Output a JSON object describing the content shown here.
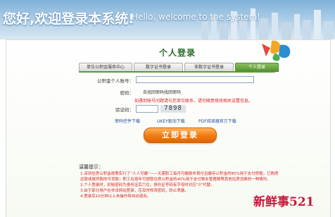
{
  "banner": {
    "title_zh": "您好,欢迎登录本系统!",
    "title_en": "Hello, welcome to the system!"
  },
  "login": {
    "title": "个人登录",
    "tabs": [
      {
        "label": "单位公积金服务中心",
        "active": false
      },
      {
        "label": "数字证书登录",
        "active": false
      },
      {
        "label": "非数字证书登录",
        "active": false
      },
      {
        "label": "个人登录",
        "active": true
      }
    ],
    "account_label": "公积金个人账号：",
    "password_label": "密码：",
    "password_hint": "去找回密码找回密码",
    "warning_text": "如遇到账号问题请与您单位联系，请勿随意修改相关设置信息。",
    "captcha_label": "验证码：",
    "captcha_value": "7898",
    "links": [
      "密码控件下载",
      "UKEY驱动下载",
      "PDF阅读器官方下载"
    ],
    "submit_label": "立即登录"
  },
  "tips": {
    "title": "温馨提示：",
    "items": [
      "1.深圳住房公积金政策实行了“人人可缴”——无需职工每月可缴款非首付且缴存公积金的85%用于支付房租；已购房",
      "还款或偿贷款的可贷款；职工在按年可提取住房公积金的40%用于支付物业管理费等其他住房消费的一种情形。",
      "2.个人登录时，初始密码为身份证后六位，身份证号码有字母时对应“0”代替。",
      "3.由于部分用户在非法网站登录，应及时修改密码，防止泄露。",
      "4.登录后10分钟以上未操作将自动退出。"
    ]
  },
  "watermark": "新鲜事521",
  "colors": {
    "accent": "#f07a12",
    "tab_active": "#4f8f2c",
    "warning": "#dd2222",
    "link": "#1f4f9a"
  }
}
